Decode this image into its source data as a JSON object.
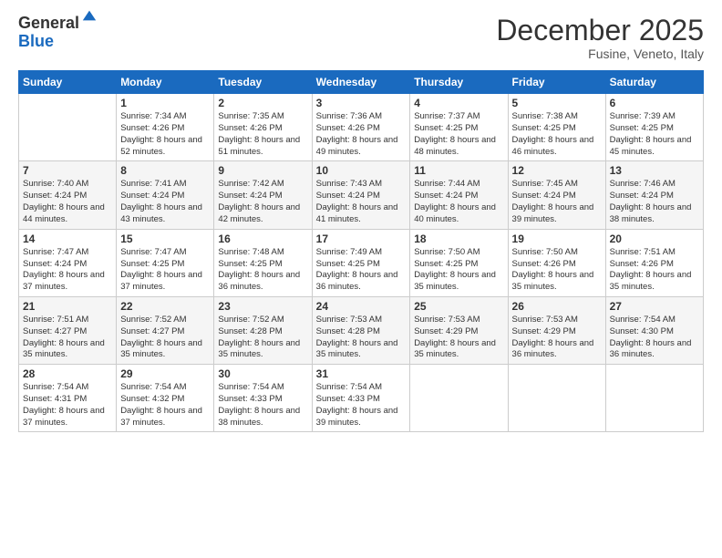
{
  "logo": {
    "general": "General",
    "blue": "Blue"
  },
  "header": {
    "month": "December 2025",
    "location": "Fusine, Veneto, Italy"
  },
  "days_of_week": [
    "Sunday",
    "Monday",
    "Tuesday",
    "Wednesday",
    "Thursday",
    "Friday",
    "Saturday"
  ],
  "weeks": [
    [
      {
        "num": "",
        "sunrise": "",
        "sunset": "",
        "daylight": ""
      },
      {
        "num": "1",
        "sunrise": "Sunrise: 7:34 AM",
        "sunset": "Sunset: 4:26 PM",
        "daylight": "Daylight: 8 hours and 52 minutes."
      },
      {
        "num": "2",
        "sunrise": "Sunrise: 7:35 AM",
        "sunset": "Sunset: 4:26 PM",
        "daylight": "Daylight: 8 hours and 51 minutes."
      },
      {
        "num": "3",
        "sunrise": "Sunrise: 7:36 AM",
        "sunset": "Sunset: 4:26 PM",
        "daylight": "Daylight: 8 hours and 49 minutes."
      },
      {
        "num": "4",
        "sunrise": "Sunrise: 7:37 AM",
        "sunset": "Sunset: 4:25 PM",
        "daylight": "Daylight: 8 hours and 48 minutes."
      },
      {
        "num": "5",
        "sunrise": "Sunrise: 7:38 AM",
        "sunset": "Sunset: 4:25 PM",
        "daylight": "Daylight: 8 hours and 46 minutes."
      },
      {
        "num": "6",
        "sunrise": "Sunrise: 7:39 AM",
        "sunset": "Sunset: 4:25 PM",
        "daylight": "Daylight: 8 hours and 45 minutes."
      }
    ],
    [
      {
        "num": "7",
        "sunrise": "Sunrise: 7:40 AM",
        "sunset": "Sunset: 4:24 PM",
        "daylight": "Daylight: 8 hours and 44 minutes."
      },
      {
        "num": "8",
        "sunrise": "Sunrise: 7:41 AM",
        "sunset": "Sunset: 4:24 PM",
        "daylight": "Daylight: 8 hours and 43 minutes."
      },
      {
        "num": "9",
        "sunrise": "Sunrise: 7:42 AM",
        "sunset": "Sunset: 4:24 PM",
        "daylight": "Daylight: 8 hours and 42 minutes."
      },
      {
        "num": "10",
        "sunrise": "Sunrise: 7:43 AM",
        "sunset": "Sunset: 4:24 PM",
        "daylight": "Daylight: 8 hours and 41 minutes."
      },
      {
        "num": "11",
        "sunrise": "Sunrise: 7:44 AM",
        "sunset": "Sunset: 4:24 PM",
        "daylight": "Daylight: 8 hours and 40 minutes."
      },
      {
        "num": "12",
        "sunrise": "Sunrise: 7:45 AM",
        "sunset": "Sunset: 4:24 PM",
        "daylight": "Daylight: 8 hours and 39 minutes."
      },
      {
        "num": "13",
        "sunrise": "Sunrise: 7:46 AM",
        "sunset": "Sunset: 4:24 PM",
        "daylight": "Daylight: 8 hours and 38 minutes."
      }
    ],
    [
      {
        "num": "14",
        "sunrise": "Sunrise: 7:47 AM",
        "sunset": "Sunset: 4:24 PM",
        "daylight": "Daylight: 8 hours and 37 minutes."
      },
      {
        "num": "15",
        "sunrise": "Sunrise: 7:47 AM",
        "sunset": "Sunset: 4:25 PM",
        "daylight": "Daylight: 8 hours and 37 minutes."
      },
      {
        "num": "16",
        "sunrise": "Sunrise: 7:48 AM",
        "sunset": "Sunset: 4:25 PM",
        "daylight": "Daylight: 8 hours and 36 minutes."
      },
      {
        "num": "17",
        "sunrise": "Sunrise: 7:49 AM",
        "sunset": "Sunset: 4:25 PM",
        "daylight": "Daylight: 8 hours and 36 minutes."
      },
      {
        "num": "18",
        "sunrise": "Sunrise: 7:50 AM",
        "sunset": "Sunset: 4:25 PM",
        "daylight": "Daylight: 8 hours and 35 minutes."
      },
      {
        "num": "19",
        "sunrise": "Sunrise: 7:50 AM",
        "sunset": "Sunset: 4:26 PM",
        "daylight": "Daylight: 8 hours and 35 minutes."
      },
      {
        "num": "20",
        "sunrise": "Sunrise: 7:51 AM",
        "sunset": "Sunset: 4:26 PM",
        "daylight": "Daylight: 8 hours and 35 minutes."
      }
    ],
    [
      {
        "num": "21",
        "sunrise": "Sunrise: 7:51 AM",
        "sunset": "Sunset: 4:27 PM",
        "daylight": "Daylight: 8 hours and 35 minutes."
      },
      {
        "num": "22",
        "sunrise": "Sunrise: 7:52 AM",
        "sunset": "Sunset: 4:27 PM",
        "daylight": "Daylight: 8 hours and 35 minutes."
      },
      {
        "num": "23",
        "sunrise": "Sunrise: 7:52 AM",
        "sunset": "Sunset: 4:28 PM",
        "daylight": "Daylight: 8 hours and 35 minutes."
      },
      {
        "num": "24",
        "sunrise": "Sunrise: 7:53 AM",
        "sunset": "Sunset: 4:28 PM",
        "daylight": "Daylight: 8 hours and 35 minutes."
      },
      {
        "num": "25",
        "sunrise": "Sunrise: 7:53 AM",
        "sunset": "Sunset: 4:29 PM",
        "daylight": "Daylight: 8 hours and 35 minutes."
      },
      {
        "num": "26",
        "sunrise": "Sunrise: 7:53 AM",
        "sunset": "Sunset: 4:29 PM",
        "daylight": "Daylight: 8 hours and 36 minutes."
      },
      {
        "num": "27",
        "sunrise": "Sunrise: 7:54 AM",
        "sunset": "Sunset: 4:30 PM",
        "daylight": "Daylight: 8 hours and 36 minutes."
      }
    ],
    [
      {
        "num": "28",
        "sunrise": "Sunrise: 7:54 AM",
        "sunset": "Sunset: 4:31 PM",
        "daylight": "Daylight: 8 hours and 37 minutes."
      },
      {
        "num": "29",
        "sunrise": "Sunrise: 7:54 AM",
        "sunset": "Sunset: 4:32 PM",
        "daylight": "Daylight: 8 hours and 37 minutes."
      },
      {
        "num": "30",
        "sunrise": "Sunrise: 7:54 AM",
        "sunset": "Sunset: 4:33 PM",
        "daylight": "Daylight: 8 hours and 38 minutes."
      },
      {
        "num": "31",
        "sunrise": "Sunrise: 7:54 AM",
        "sunset": "Sunset: 4:33 PM",
        "daylight": "Daylight: 8 hours and 39 minutes."
      },
      {
        "num": "",
        "sunrise": "",
        "sunset": "",
        "daylight": ""
      },
      {
        "num": "",
        "sunrise": "",
        "sunset": "",
        "daylight": ""
      },
      {
        "num": "",
        "sunrise": "",
        "sunset": "",
        "daylight": ""
      }
    ]
  ]
}
